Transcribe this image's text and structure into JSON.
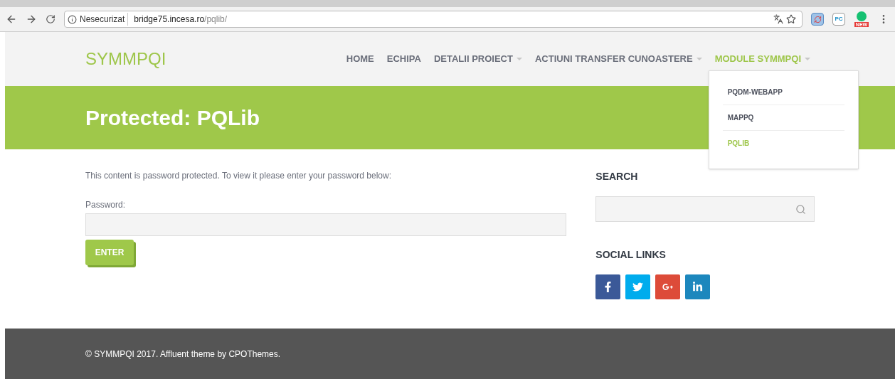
{
  "browser": {
    "security": "Nesecurizat",
    "url_host": "bridge75.incesa.ro",
    "url_path": "/pqlib/",
    "extensions": [
      {
        "kind": "refresh"
      },
      {
        "kind": "pc",
        "label": "PC"
      },
      {
        "kind": "grammar",
        "badge": "NEW"
      }
    ]
  },
  "site": {
    "logo": "SYMMPQI",
    "nav": [
      {
        "label": "HOME",
        "has_dropdown": false,
        "selected": false
      },
      {
        "label": "ECHIPA",
        "has_dropdown": false,
        "selected": false
      },
      {
        "label": "DETALII PROIECT",
        "has_dropdown": true,
        "selected": false
      },
      {
        "label": "ACTIUNI TRANSFER CUNOASTERE",
        "has_dropdown": true,
        "selected": false
      },
      {
        "label": "MODULE SYMMPQI",
        "has_dropdown": true,
        "selected": true,
        "expanded": true
      }
    ],
    "submenu": [
      {
        "label": "PQDM-WEBAPP",
        "selected": false
      },
      {
        "label": "MAPPQ",
        "selected": false
      },
      {
        "label": "PQLIB",
        "selected": true
      }
    ]
  },
  "page_title": "Protected: PQLib",
  "main": {
    "notice": "This content is password protected. To view it please enter your password below:",
    "password_label": "Password:",
    "button": "ENTER"
  },
  "sidebar": {
    "search_heading": "SEARCH",
    "social_heading": "SOCIAL LINKS",
    "social": [
      {
        "kind": "facebook",
        "color": "#3b5998"
      },
      {
        "kind": "twitter",
        "color": "#00aced"
      },
      {
        "kind": "googleplus",
        "color": "#dd4b39"
      },
      {
        "kind": "linkedin",
        "color": "#1c87bd"
      }
    ]
  },
  "footer": "© SYMMPQI 2017. Affluent theme by CPOThemes."
}
